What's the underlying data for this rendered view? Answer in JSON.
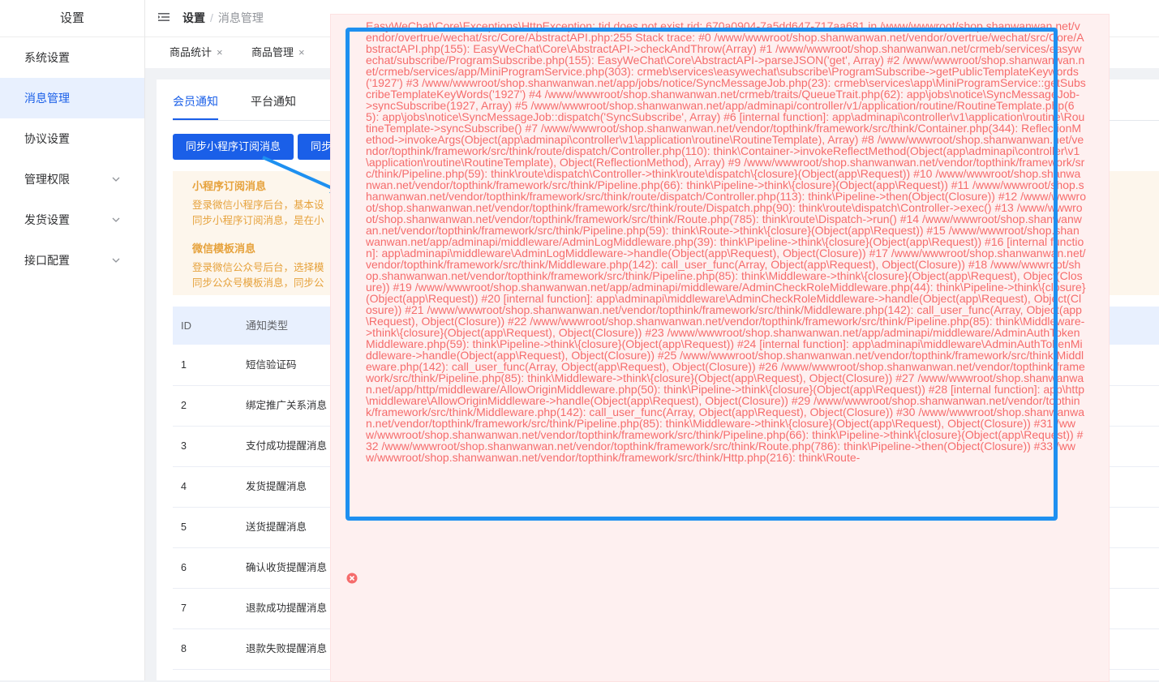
{
  "sidebar": {
    "title": "设置",
    "items": [
      {
        "label": "系统设置"
      },
      {
        "label": "消息管理"
      },
      {
        "label": "协议设置"
      },
      {
        "label": "管理权限"
      },
      {
        "label": "发货设置"
      },
      {
        "label": "接口配置"
      }
    ]
  },
  "header": {
    "breadcrumb_parent": "设置",
    "breadcrumb_sep": "/",
    "breadcrumb_current": "消息管理"
  },
  "tags": [
    {
      "label": "商品统计"
    },
    {
      "label": "商品管理"
    }
  ],
  "tag_close": "×",
  "tabs": [
    {
      "label": "会员通知"
    },
    {
      "label": "平台通知"
    }
  ],
  "buttons": {
    "sync_mini": "同步小程序订阅消息",
    "sync_mp": "同步"
  },
  "notice": {
    "mini_title": "小程序订阅消息",
    "mini_line1": "登录微信小程序后台，基本设",
    "mini_line2": "同步小程序订阅消息，是在小",
    "wx_title": "微信模板消息",
    "wx_line1": "登录微信公众号后台，选择模",
    "wx_line2": "同步公众号模板消息，同步公"
  },
  "table": {
    "headers": [
      "ID",
      "通知类型"
    ],
    "rows": [
      [
        "1",
        "短信验证码"
      ],
      [
        "2",
        "绑定推广关系消息"
      ],
      [
        "3",
        "支付成功提醒消息"
      ],
      [
        "4",
        "发货提醒消息"
      ],
      [
        "5",
        "送货提醒消息"
      ],
      [
        "6",
        "确认收货提醒消息"
      ],
      [
        "7",
        "退款成功提醒消息"
      ],
      [
        "8",
        "退款失败提醒消息"
      ]
    ]
  },
  "error": {
    "message": "EasyWeChat\\Core\\Exceptions\\HttpException: tid does not exist rid: 670a0904-7a5dd647-717aa681 in /www/wwwroot/shop.shanwanwan.net/vendor/overtrue/wechat/src/Core/AbstractAPI.php:255 Stack trace: #0 /www/wwwroot/shop.shanwanwan.net/vendor/overtrue/wechat/src/Core/AbstractAPI.php(155): EasyWeChat\\Core\\AbstractAPI->checkAndThrow(Array) #1 /www/wwwroot/shop.shanwanwan.net/crmeb/services/easywechat/subscribe/ProgramSubscribe.php(155): EasyWeChat\\Core\\AbstractAPI->parseJSON('get', Array) #2 /www/wwwroot/shop.shanwanwan.net/crmeb/services/app/MiniProgramService.php(303): crmeb\\services\\easywechat\\subscribe\\ProgramSubscribe->getPublicTemplateKeywords('1927') #3 /www/wwwroot/shop.shanwanwan.net/app/jobs/notice/SyncMessageJob.php(23): crmeb\\services\\app\\MiniProgramService::getSubscribeTemplateKeyWords('1927') #4 /www/wwwroot/shop.shanwanwan.net/crmeb/traits/QueueTrait.php(62): app\\jobs\\notice\\SyncMessageJob->syncSubscribe(1927, Array) #5 /www/wwwroot/shop.shanwanwan.net/app/adminapi/controller/v1/application/routine/RoutineTemplate.php(65): app\\jobs\\notice\\SyncMessageJob::dispatch('SyncSubscribe', Array) #6 [internal function]: app\\adminapi\\controller\\v1\\application\\routine\\RoutineTemplate->syncSubscribe() #7 /www/wwwroot/shop.shanwanwan.net/vendor/topthink/framework/src/think/Container.php(344): ReflectionMethod->invokeArgs(Object(app\\adminapi\\controller\\v1\\application\\routine\\RoutineTemplate), Array) #8 /www/wwwroot/shop.shanwanwan.net/vendor/topthink/framework/src/think/route/dispatch/Controller.php(110): think\\Container->invokeReflectMethod(Object(app\\adminapi\\controller\\v1\\application\\routine\\RoutineTemplate), Object(ReflectionMethod), Array) #9 /www/wwwroot/shop.shanwanwan.net/vendor/topthink/framework/src/think/Pipeline.php(59): think\\route\\dispatch\\Controller->think\\route\\dispatch\\{closure}(Object(app\\Request)) #10 /www/wwwroot/shop.shanwanwan.net/vendor/topthink/framework/src/think/Pipeline.php(66): think\\Pipeline->think\\{closure}(Object(app\\Request)) #11 /www/wwwroot/shop.shanwanwan.net/vendor/topthink/framework/src/think/route/dispatch/Controller.php(113): think\\Pipeline->then(Object(Closure)) #12 /www/wwwroot/shop.shanwanwan.net/vendor/topthink/framework/src/think/route/Dispatch.php(90): think\\route\\dispatch\\Controller->exec() #13 /www/wwwroot/shop.shanwanwan.net/vendor/topthink/framework/src/think/Route.php(785): think\\route\\Dispatch->run() #14 /www/wwwroot/shop.shanwanwan.net/vendor/topthink/framework/src/think/Pipeline.php(59): think\\Route->think\\{closure}(Object(app\\Request)) #15 /www/wwwroot/shop.shanwanwan.net/app/adminapi/middleware/AdminLogMiddleware.php(39): think\\Pipeline->think\\{closure}(Object(app\\Request)) #16 [internal function]: app\\adminapi\\middleware\\AdminLogMiddleware->handle(Object(app\\Request), Object(Closure)) #17 /www/wwwroot/shop.shanwanwan.net/vendor/topthink/framework/src/think/Middleware.php(142): call_user_func(Array, Object(app\\Request), Object(Closure)) #18 /www/wwwroot/shop.shanwanwan.net/vendor/topthink/framework/src/think/Pipeline.php(85): think\\Middleware->think\\{closure}(Object(app\\Request), Object(Closure)) #19 /www/wwwroot/shop.shanwanwan.net/app/adminapi/middleware/AdminCheckRoleMiddleware.php(44): think\\Pipeline->think\\{closure}(Object(app\\Request)) #20 [internal function]: app\\adminapi\\middleware\\AdminCheckRoleMiddleware->handle(Object(app\\Request), Object(Closure)) #21 /www/wwwroot/shop.shanwanwan.net/vendor/topthink/framework/src/think/Middleware.php(142): call_user_func(Array, Object(app\\Request), Object(Closure)) #22 /www/wwwroot/shop.shanwanwan.net/vendor/topthink/framework/src/think/Pipeline.php(85): think\\Middleware->think\\{closure}(Object(app\\Request), Object(Closure)) #23 /www/wwwroot/shop.shanwanwan.net/app/adminapi/middleware/AdminAuthTokenMiddleware.php(59): think\\Pipeline->think\\{closure}(Object(app\\Request)) #24 [internal function]: app\\adminapi\\middleware\\AdminAuthTokenMiddleware->handle(Object(app\\Request), Object(Closure)) #25 /www/wwwroot/shop.shanwanwan.net/vendor/topthink/framework/src/think/Middleware.php(142): call_user_func(Array, Object(app\\Request), Object(Closure)) #26 /www/wwwroot/shop.shanwanwan.net/vendor/topthink/framework/src/think/Pipeline.php(85): think\\Middleware->think\\{closure}(Object(app\\Request), Object(Closure)) #27 /www/wwwroot/shop.shanwanwan.net/app/http/middleware/AllowOriginMiddleware.php(50): think\\Pipeline->think\\{closure}(Object(app\\Request)) #28 [internal function]: app\\http\\middleware\\AllowOriginMiddleware->handle(Object(app\\Request), Object(Closure)) #29 /www/wwwroot/shop.shanwanwan.net/vendor/topthink/framework/src/think/Middleware.php(142): call_user_func(Array, Object(app\\Request), Object(Closure)) #30 /www/wwwroot/shop.shanwanwan.net/vendor/topthink/framework/src/think/Pipeline.php(85): think\\Middleware->think\\{closure}(Object(app\\Request), Object(Closure)) #31 /www/wwwroot/shop.shanwanwan.net/vendor/topthink/framework/src/think/Pipeline.php(66): think\\Pipeline->think\\{closure}(Object(app\\Request)) #32 /www/wwwroot/shop.shanwanwan.net/vendor/topthink/framework/src/think/Route.php(786): think\\Pipeline->then(Object(Closure)) #33 /www/wwwroot/shop.shanwanwan.net/vendor/topthink/framework/src/think/Http.php(216): think\\Route-"
  },
  "colors": {
    "primary": "#1a5fe8",
    "error_text": "#f56c6c",
    "error_bg": "#fef0f0",
    "warning_text": "#e6a23c",
    "warning_bg": "#fdf6ec",
    "highlight_border": "#1e90f0"
  },
  "icons": {
    "menu": "menu-fold-icon",
    "chevron": "chevron-down-icon",
    "error": "error-circle-icon"
  }
}
